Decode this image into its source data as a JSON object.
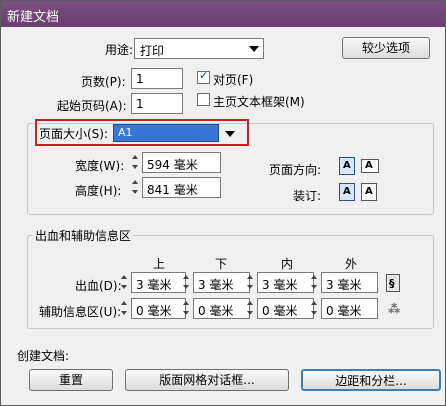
{
  "window": {
    "title": "新建文档"
  },
  "top": {
    "purpose_label": "用途:",
    "purpose_value": "打印",
    "fewer_options": "较少选项",
    "pages_label": "页数(P):",
    "pages_value": "1",
    "facing_pages": "对页(F)",
    "facing_pages_checked": true,
    "start_page_label": "起始页码(A):",
    "start_page_value": "1",
    "master_text_frame": "主页文本框架(M)",
    "master_text_frame_checked": false
  },
  "page_size": {
    "label": "页面大小(S):",
    "value": "A1",
    "width_label": "宽度(W):",
    "width_value": "594 毫米",
    "height_label": "高度(H):",
    "height_value": "841 毫米",
    "orientation_label": "页面方向:",
    "binding_label": "装订:"
  },
  "bleed": {
    "section_title": "出血和辅助信息区",
    "columns": [
      "上",
      "下",
      "内",
      "外"
    ],
    "bleed_label": "出血(D):",
    "bleed_values": [
      "3 毫米",
      "3 毫米",
      "3 毫米",
      "3 毫米"
    ],
    "slug_label": "辅助信息区(U):",
    "slug_values": [
      "0 毫米",
      "0 毫米",
      "0 毫米",
      "0 毫米"
    ]
  },
  "create": {
    "label": "创建文档:",
    "reset": "重置",
    "layout_grid": "版面网格对话框...",
    "margins_columns": "边距和分栏..."
  }
}
